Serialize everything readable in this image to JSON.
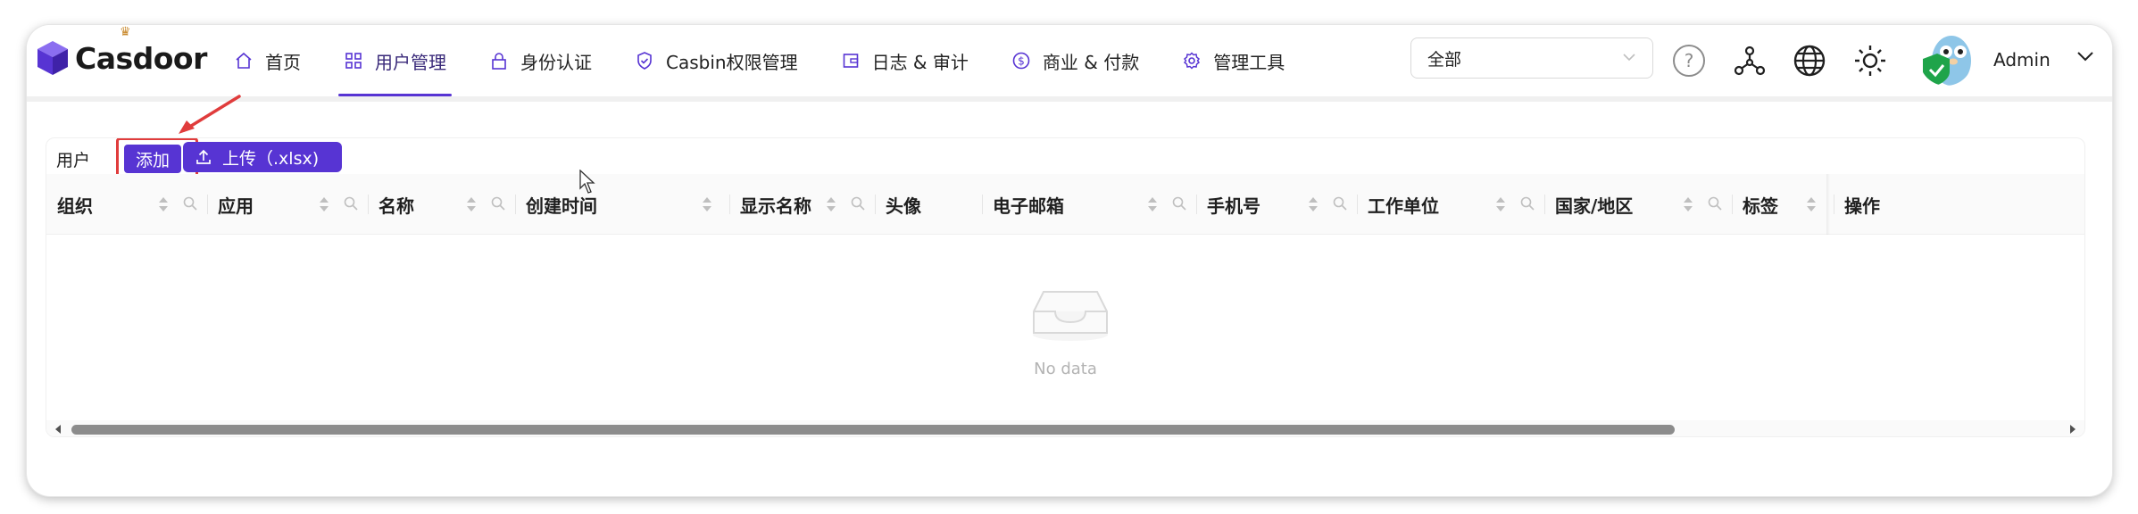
{
  "app": {
    "brand": "Casdoor"
  },
  "nav": {
    "items": [
      {
        "label": "首页",
        "icon": "home-icon",
        "active": false
      },
      {
        "label": "用户管理",
        "icon": "appstore-icon",
        "active": true
      },
      {
        "label": "身份认证",
        "icon": "lock-icon",
        "active": false
      },
      {
        "label": "Casbin权限管理",
        "icon": "safety-check-icon",
        "active": false
      },
      {
        "label": "日志 & 审计",
        "icon": "wallet-icon",
        "active": false
      },
      {
        "label": "商业 & 付款",
        "icon": "dollar-circle-icon",
        "active": false
      },
      {
        "label": "管理工具",
        "icon": "settings-gear-icon",
        "active": false
      }
    ]
  },
  "header": {
    "org_select_value": "全部",
    "user_name": "Admin"
  },
  "toolbar": {
    "title": "用户",
    "add_label": "添加",
    "upload_label": "上传（.xlsx)"
  },
  "table": {
    "columns": [
      {
        "label": "组织",
        "sortable": true,
        "filterable": true
      },
      {
        "label": "应用",
        "sortable": true,
        "filterable": true
      },
      {
        "label": "名称",
        "sortable": true,
        "filterable": true
      },
      {
        "label": "创建时间",
        "sortable": true,
        "filterable": false
      },
      {
        "label": "显示名称",
        "sortable": true,
        "filterable": true
      },
      {
        "label": "头像",
        "sortable": false,
        "filterable": false
      },
      {
        "label": "电子邮箱",
        "sortable": true,
        "filterable": true
      },
      {
        "label": "手机号",
        "sortable": true,
        "filterable": true
      },
      {
        "label": "工作单位",
        "sortable": true,
        "filterable": true
      },
      {
        "label": "国家/地区",
        "sortable": true,
        "filterable": true
      },
      {
        "label": "标签",
        "sortable": true,
        "filterable": false
      },
      {
        "label": "操作",
        "sortable": false,
        "filterable": false
      }
    ],
    "empty_text": "No data"
  },
  "colors": {
    "primary": "#5734d3",
    "highlight": "#e03c3c"
  }
}
